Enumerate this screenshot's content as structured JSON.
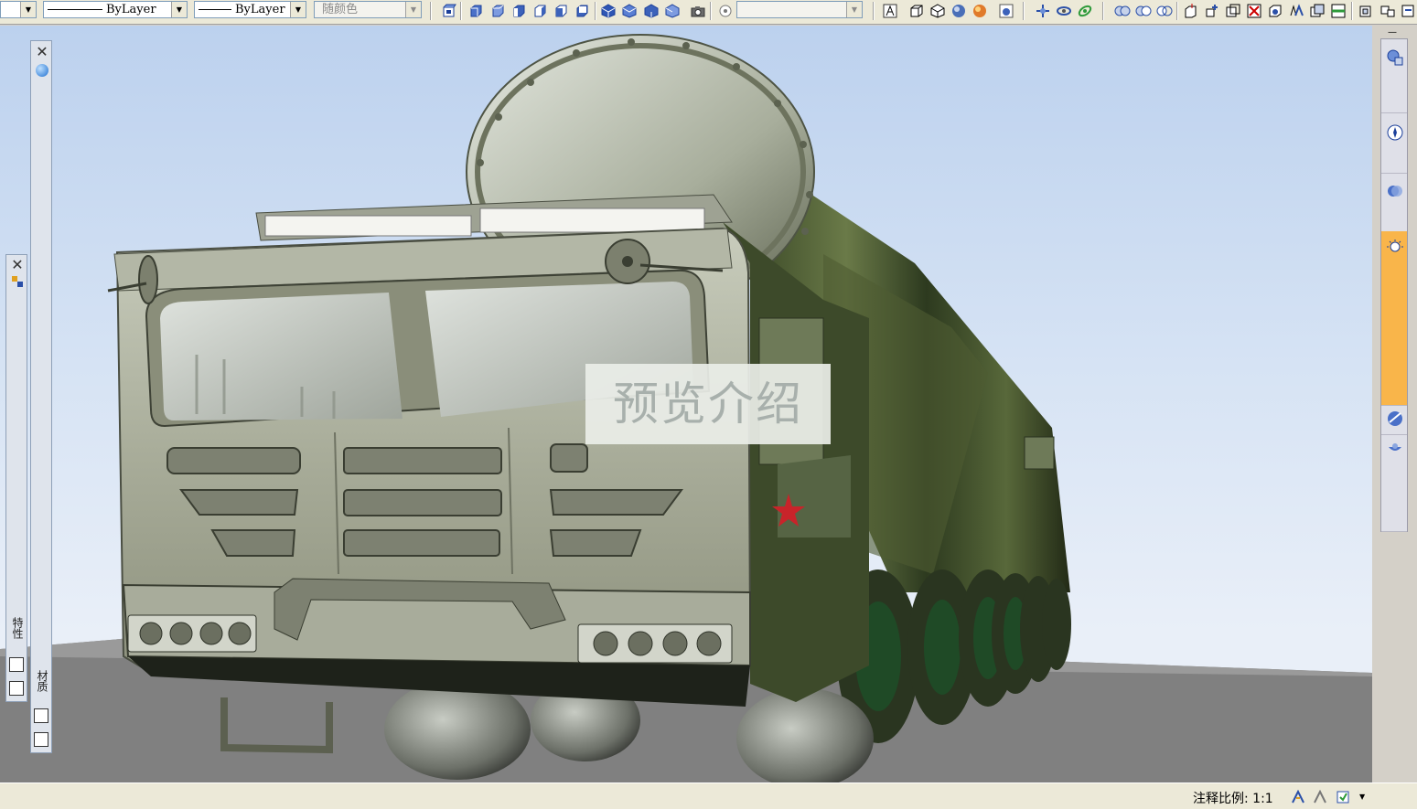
{
  "toolbar": {
    "linetype_value": "ByLayer",
    "lineweight_value": "ByLayer",
    "plotstyle_value": "随颜色"
  },
  "viewport": {
    "watermark_text": "预览介绍"
  },
  "palettes": {
    "properties_label": "特性",
    "materials_label": "材质"
  },
  "statusbar": {
    "annotation_scale_label": "注释比例:",
    "annotation_scale_value": "1:1"
  },
  "colors": {
    "accent_active": "#f9b54a",
    "sky_top": "#bcd1ee",
    "ground": "#808080"
  },
  "icons": {
    "toolbar": [
      "3d-box-icon",
      "view-top-icon",
      "view-bottom-icon",
      "view-left-icon",
      "view-right-icon",
      "view-front-icon",
      "view-back-icon",
      "iso-sw-icon",
      "iso-se-icon",
      "iso-ne-icon",
      "iso-nw-icon",
      "camera-icon",
      "ucs-icon",
      "wireframe-icon",
      "hidden-icon",
      "realistic-icon",
      "conceptual-icon",
      "visual-style-manager-icon",
      "pan-icon",
      "orbit-icon",
      "free-orbit-icon",
      "solid-union-icon",
      "solid-subtract-icon",
      "solid-intersect-icon",
      "extrude-icon",
      "move-3d-icon",
      "rotate-3d-icon",
      "align-3d-icon",
      "mirror-3d-icon",
      "array-3d-icon",
      "slice-icon",
      "section-icon"
    ]
  }
}
